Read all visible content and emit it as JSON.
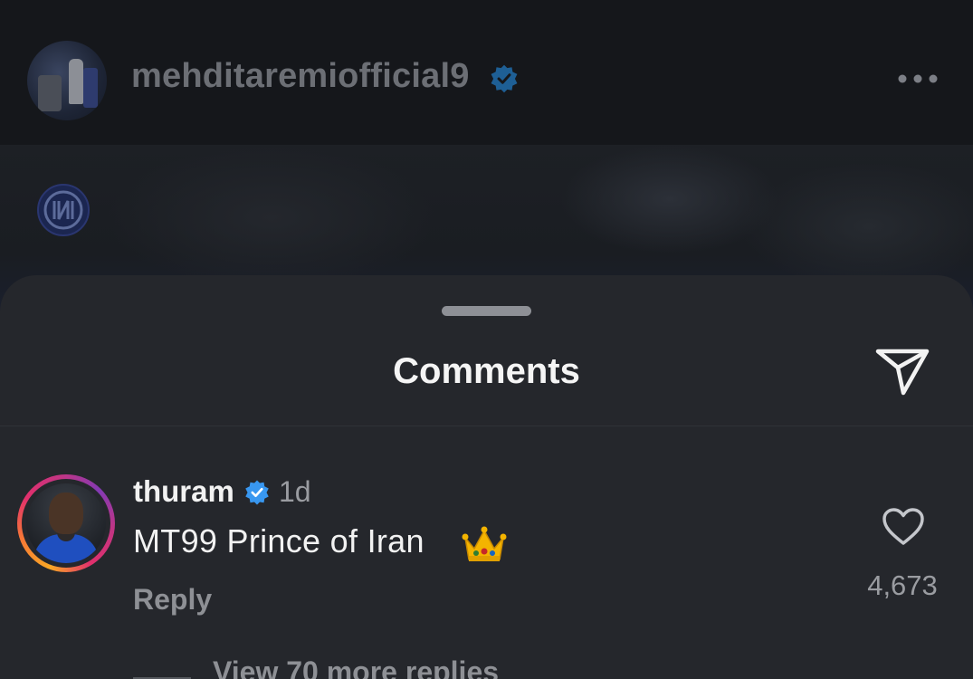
{
  "post_header": {
    "username": "mehditaremiofficial9",
    "verified_icon": "verified-badge-icon",
    "more_icon": "more-dots-icon"
  },
  "post_image": {
    "logo_icon": "club-logo-icon"
  },
  "comments_sheet": {
    "title": "Comments",
    "share_icon": "send-icon"
  },
  "comment": {
    "username": "thuram",
    "time": "1d",
    "text": "MT99 Prince of Iran",
    "emoji_icon": "crown-icon",
    "reply_label": "Reply",
    "like_icon": "heart-icon",
    "like_count": "4,673",
    "view_replies_label": "View 70 more replies"
  },
  "colors": {
    "sheet_background": "#25272c",
    "verified_blue": "#3897f0",
    "text_primary": "#f2f2f2",
    "text_secondary": "#9a9ca1"
  }
}
